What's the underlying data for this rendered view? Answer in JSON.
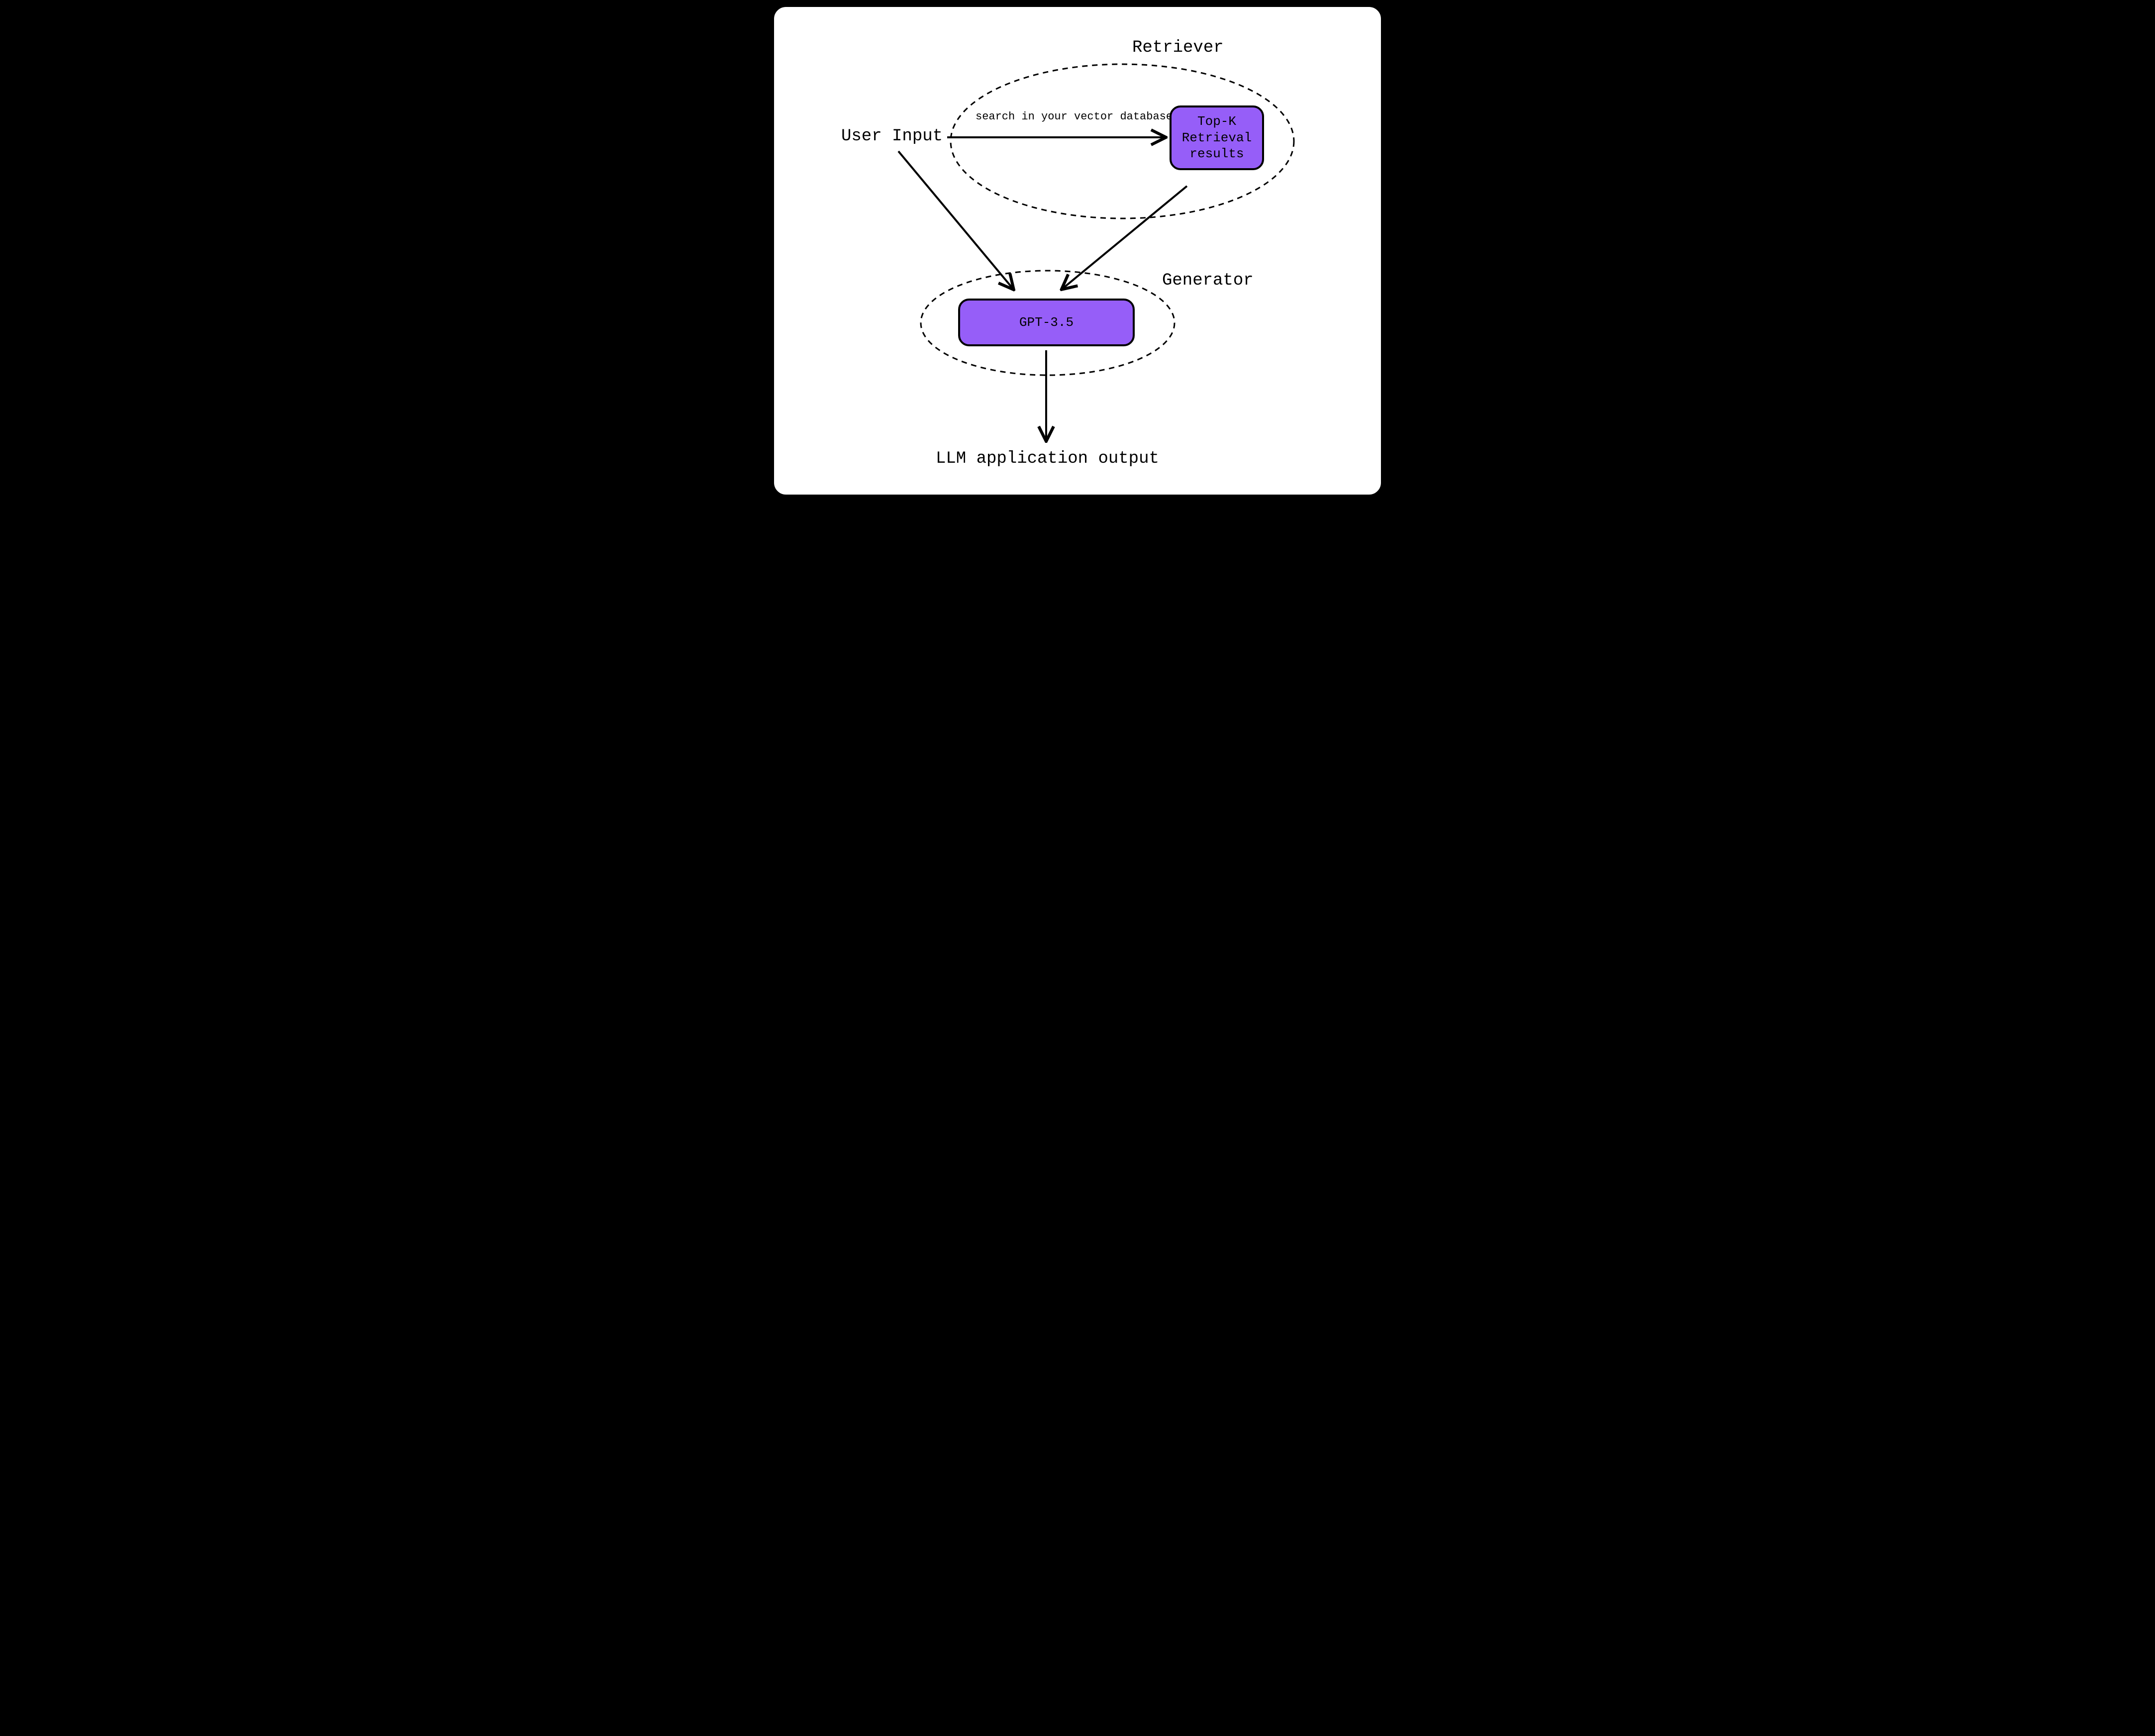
{
  "labels": {
    "retriever": "Retriever",
    "generator": "Generator",
    "user_input": "User Input",
    "search_hint": "search in your vector database",
    "output": "LLM application output"
  },
  "nodes": {
    "topk": "Top-K\nRetrieval\nresults",
    "gpt": "GPT-3.5"
  },
  "colors": {
    "accent": "#965ef8",
    "stroke": "#000000"
  }
}
